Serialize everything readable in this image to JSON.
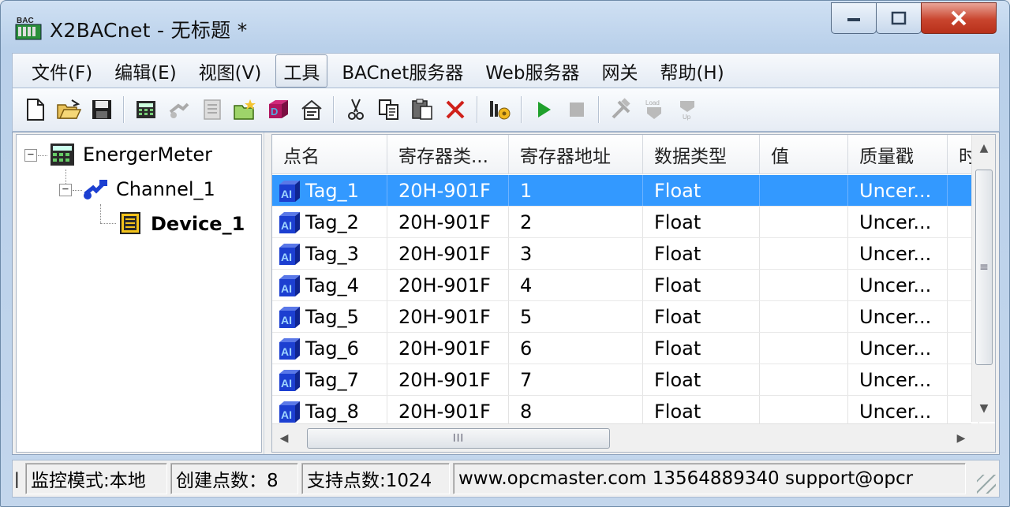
{
  "window": {
    "title": "X2BACnet - 无标题 *",
    "app_icon": "bac-app-icon"
  },
  "menu": [
    {
      "label": "文件(F)"
    },
    {
      "label": "编辑(E)"
    },
    {
      "label": "视图(V)"
    },
    {
      "label": "工具",
      "active": true
    },
    {
      "label": "BACnet服务器"
    },
    {
      "label": "Web服务器"
    },
    {
      "label": "网关"
    },
    {
      "label": "帮助(H)"
    }
  ],
  "toolbar_icons": [
    "new-file-icon",
    "open-folder-icon",
    "save-icon",
    "add-device-icon",
    "add-channel-icon",
    "add-group-icon",
    "open-project-icon",
    "add-tag-icon",
    "properties-icon",
    "cut-icon",
    "copy-icon",
    "paste-icon",
    "delete-icon",
    "config-icon",
    "run-icon",
    "stop-icon",
    "tools-icon",
    "load-icon",
    "upload-icon"
  ],
  "tree": {
    "root": {
      "label": "EnergerMeter",
      "icon": "meter-icon"
    },
    "channel": {
      "label": "Channel_1",
      "icon": "channel-icon"
    },
    "device": {
      "label": "Device_1",
      "icon": "device-icon"
    }
  },
  "grid": {
    "columns": [
      "点名",
      "寄存器类...",
      "寄存器地址",
      "数据类型",
      "值",
      "质量戳",
      "时"
    ],
    "rows": [
      {
        "name": "Tag_1",
        "reg_type": "20H-901F",
        "address": "1",
        "dtype": "Float",
        "value": "",
        "quality": "Uncer...",
        "selected": true
      },
      {
        "name": "Tag_2",
        "reg_type": "20H-901F",
        "address": "2",
        "dtype": "Float",
        "value": "",
        "quality": "Uncer..."
      },
      {
        "name": "Tag_3",
        "reg_type": "20H-901F",
        "address": "3",
        "dtype": "Float",
        "value": "",
        "quality": "Uncer..."
      },
      {
        "name": "Tag_4",
        "reg_type": "20H-901F",
        "address": "4",
        "dtype": "Float",
        "value": "",
        "quality": "Uncer..."
      },
      {
        "name": "Tag_5",
        "reg_type": "20H-901F",
        "address": "5",
        "dtype": "Float",
        "value": "",
        "quality": "Uncer..."
      },
      {
        "name": "Tag_6",
        "reg_type": "20H-901F",
        "address": "6",
        "dtype": "Float",
        "value": "",
        "quality": "Uncer..."
      },
      {
        "name": "Tag_7",
        "reg_type": "20H-901F",
        "address": "7",
        "dtype": "Float",
        "value": "",
        "quality": "Uncer..."
      },
      {
        "name": "Tag_8",
        "reg_type": "20H-901F",
        "address": "8",
        "dtype": "Float",
        "value": "",
        "quality": "Uncer..."
      }
    ]
  },
  "scroll": {
    "h_thumb_glyph": "III"
  },
  "status": {
    "left_glyph": "|",
    "mode": "监控模式:本地",
    "created": "创建点数：8",
    "supported": "支持点数:1024",
    "contact": "www.opcmaster.com 13564889340 support@opcr"
  },
  "colors": {
    "selection": "#3399ff",
    "tag_icon": "#1c3fd1"
  }
}
